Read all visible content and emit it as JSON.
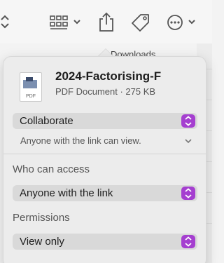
{
  "toolbar": {
    "icons": [
      "chevron-updown-icon",
      "grid-view-icon",
      "share-icon",
      "tag-icon",
      "more-icon"
    ]
  },
  "background": {
    "partial_text": "Downloads"
  },
  "file": {
    "name": "2024-Factorising-F",
    "meta": "PDF Document · 275 KB",
    "icon_ext": "PDF"
  },
  "collaborate": {
    "selected": "Collaborate",
    "info": "Anyone with the link can view."
  },
  "access": {
    "label": "Who can access",
    "selected": "Anyone with the link"
  },
  "permissions": {
    "label": "Permissions",
    "selected": "View only"
  },
  "colors": {
    "accent": "#a53fd0"
  }
}
